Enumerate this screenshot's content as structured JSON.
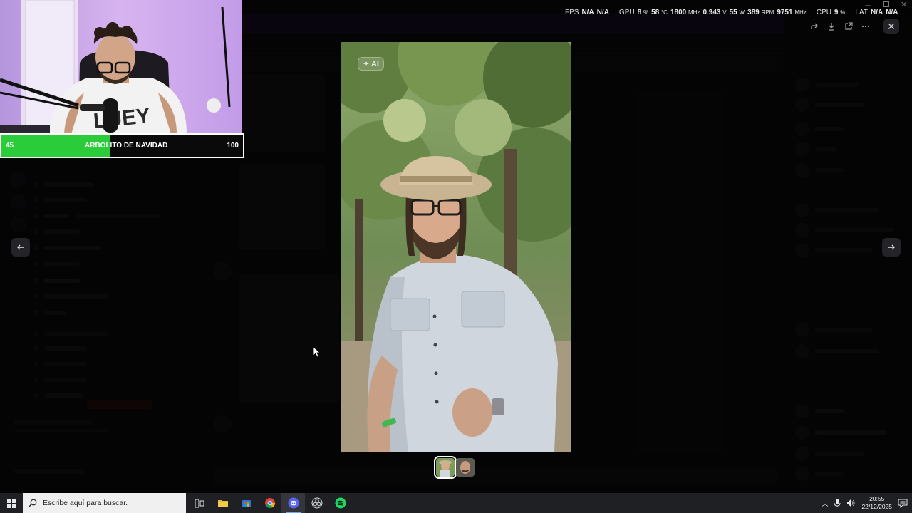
{
  "stats_overlay": {
    "fps_label": "FPS",
    "fps_value1": "N/A",
    "fps_value2": "N/A",
    "gpu_label": "GPU",
    "gpu_load": "8",
    "gpu_load_unit": "%",
    "gpu_temp": "58",
    "gpu_temp_unit": "°C",
    "gpu_clock": "1800",
    "gpu_clock_unit": "MHz",
    "gpu_voltage": "0.943",
    "gpu_voltage_unit": "V",
    "gpu_power": "55",
    "gpu_power_unit": "W",
    "gpu_fan": "389",
    "gpu_fan_unit": "RPM",
    "gpu_mem_clock": "9751",
    "gpu_mem_clock_unit": "MHz",
    "cpu_label": "CPU",
    "cpu_load": "9",
    "cpu_load_unit": "%",
    "lat_label": "LAT",
    "lat_value1": "N/A",
    "lat_value2": "N/A"
  },
  "viewer": {
    "ai_badge": "AI",
    "icons": [
      "forward-icon",
      "download-icon",
      "open-external-icon",
      "more-icon"
    ],
    "close_icon": "close-icon",
    "prev_icon": "arrow-left-icon",
    "next_icon": "arrow-right-icon",
    "thumbnail_count": 2,
    "active_thumbnail": 0
  },
  "stream_goal": {
    "current": "45",
    "title": "ARBOLITO DE NAVIDAD",
    "target": "100",
    "progress": 0.45
  },
  "taskbar": {
    "search_placeholder": "Escribe aquí para buscar.",
    "time": "20:55",
    "date": "22/12/2025",
    "apps": [
      "task-view-icon",
      "file-explorer-icon",
      "store-icon",
      "chrome-icon",
      "discord-icon",
      "obs-icon",
      "spotify-icon"
    ],
    "active_app": "discord-icon"
  },
  "colors": {
    "goal_fill": "#2bcc3a",
    "spotify": "#1ed760",
    "discord": "#5865f2"
  }
}
